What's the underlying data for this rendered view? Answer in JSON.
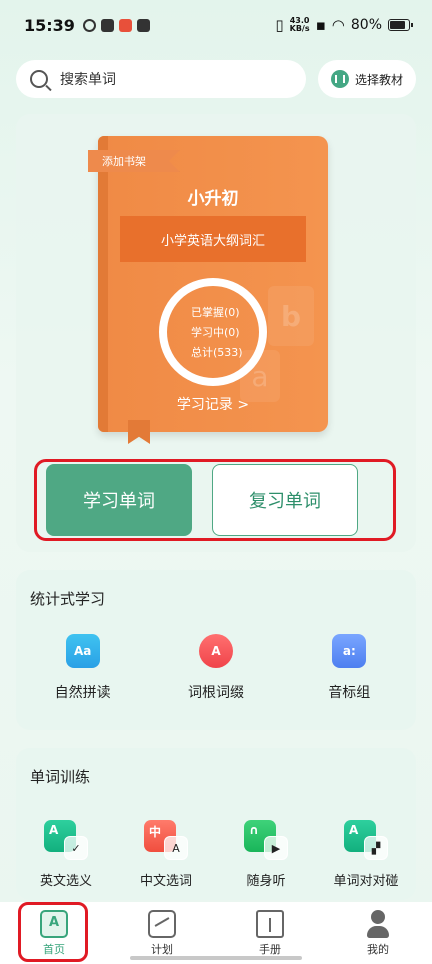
{
  "status": {
    "time": "15:39",
    "net_speed_top": "43.0",
    "net_speed_bottom": "KB/s",
    "battery": "80%"
  },
  "search": {
    "placeholder": "搜索单词",
    "textbook_label": "选择教材"
  },
  "book": {
    "bookshelf_tag": "添加书架",
    "title": "小升初",
    "subtitle": "小学英语大纲词汇",
    "stats": {
      "mastered": "已掌握(0)",
      "learning": "学习中(0)",
      "total": "总计(533)"
    },
    "record_link": "学习记录 >",
    "cover_color": "#f08a45"
  },
  "actions": {
    "learn": "学习单词",
    "review": "复习单词",
    "accent": "#4fa884"
  },
  "statistical": {
    "title": "统计式学习",
    "items": [
      {
        "label": "自然拼读",
        "icon": "Aa"
      },
      {
        "label": "词根词缀",
        "icon": "A"
      },
      {
        "label": "音标组",
        "icon": "a:"
      }
    ]
  },
  "training": {
    "title": "单词训练",
    "items": [
      {
        "label": "英文选义",
        "icon": "A"
      },
      {
        "label": "中文选词",
        "icon": "中"
      },
      {
        "label": "随身听",
        "icon": "headphone"
      },
      {
        "label": "单词对对碰",
        "icon": "A"
      }
    ]
  },
  "nav": {
    "items": [
      {
        "label": "首页"
      },
      {
        "label": "计划"
      },
      {
        "label": "手册"
      },
      {
        "label": "我的"
      }
    ]
  }
}
